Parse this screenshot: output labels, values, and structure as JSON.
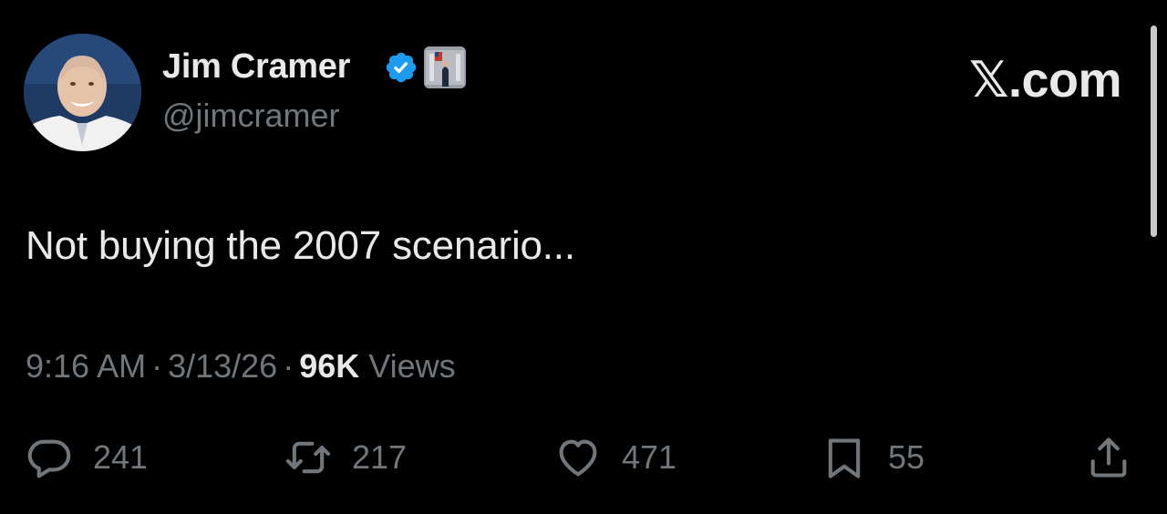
{
  "author": {
    "display_name": "Jim Cramer",
    "handle": "@jimcramer",
    "verified_icon": "verified-badge-icon",
    "affiliate_icon": "affiliate-badge-icon"
  },
  "brand": "𝕏.com",
  "tweet": {
    "text": "Not buying the 2007 scenario..."
  },
  "meta": {
    "time": "9:16 AM",
    "separator": "·",
    "date": "3/13/26",
    "views_count": "96K",
    "views_label": "Views"
  },
  "actions": {
    "replies": "241",
    "retweets": "217",
    "likes": "471",
    "bookmarks": "55"
  },
  "colors": {
    "background": "#000000",
    "primary_text": "#e7e9ea",
    "secondary_text": "#71767b",
    "verified_blue": "#1d9bf0"
  }
}
